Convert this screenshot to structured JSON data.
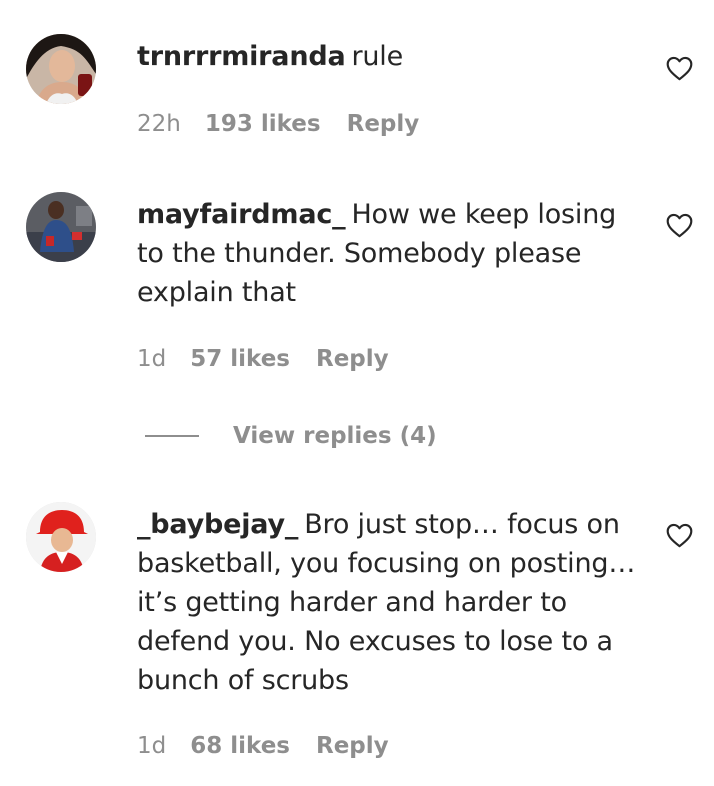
{
  "comments": [
    {
      "username": "trnrrrmiranda",
      "text": "rule",
      "time": "22h",
      "likes": "193 likes",
      "reply": "Reply"
    },
    {
      "username": "mayfairdmac_",
      "text": "How we keep losing to the thunder. Somebody please explain that",
      "time": "1d",
      "likes": "57 likes",
      "reply": "Reply"
    },
    {
      "username": "_baybejay_",
      "text": "Bro just stop… focus on basketball, you focusing on posting… it’s getting harder and harder to defend you. No excuses to lose to a bunch of scrubs",
      "time": "1d",
      "likes": "68 likes",
      "reply": "Reply"
    }
  ],
  "view_replies": "View replies (4)",
  "colors": {
    "text": "#262626",
    "muted": "#8e8e8e"
  },
  "icons": {
    "like": "heart-outline-icon"
  }
}
